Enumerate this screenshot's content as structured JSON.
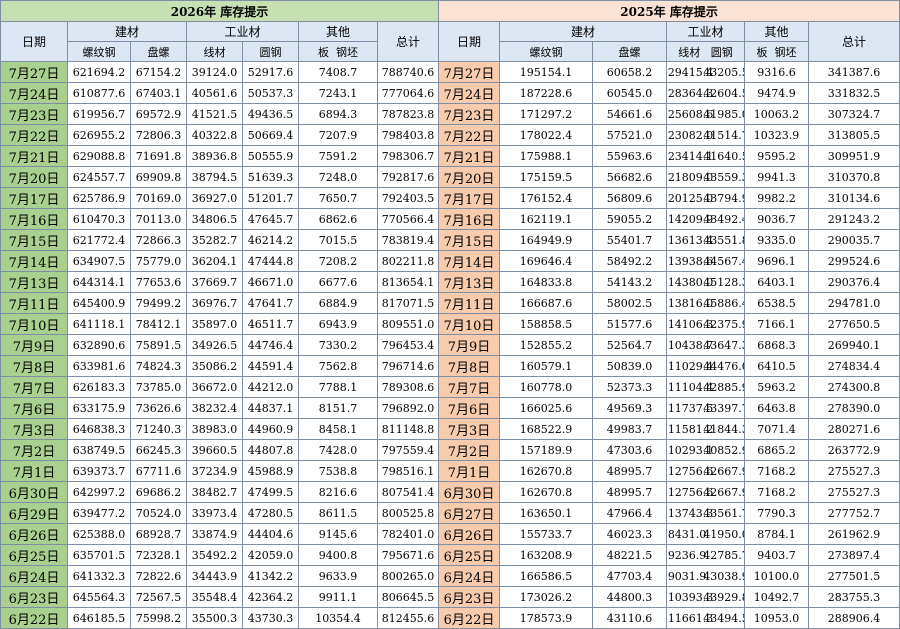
{
  "left_title": "2026年 库存提示",
  "right_title": "2025年 库存提示",
  "headers": {
    "date": "日期",
    "building": "建材",
    "industrial": "工业材",
    "other": "其他",
    "total": "总计",
    "rebar": "螺纹钢",
    "coil": "盘螺",
    "wire": "线材",
    "round": "圆钢",
    "plate": "板",
    "billet": "钢坯"
  },
  "rows_2026": [
    {
      "date": "7月27日",
      "vals": [
        "621694.2",
        "67154.2",
        "39124.0",
        "52917.6",
        "7408.7",
        "788740.6"
      ]
    },
    {
      "date": "7月24日",
      "vals": [
        "610877.6",
        "67403.1",
        "40561.6",
        "50537.3",
        "7243.1",
        "777064.6"
      ]
    },
    {
      "date": "7月23日",
      "vals": [
        "619956.7",
        "69572.9",
        "41521.5",
        "49436.5",
        "6894.3",
        "787823.8"
      ]
    },
    {
      "date": "7月22日",
      "vals": [
        "626955.2",
        "72806.3",
        "40322.8",
        "50669.4",
        "7207.9",
        "798403.8"
      ]
    },
    {
      "date": "7月21日",
      "vals": [
        "629088.8",
        "71691.8",
        "38936.8",
        "50555.9",
        "7591.2",
        "798306.7"
      ]
    },
    {
      "date": "7月20日",
      "vals": [
        "624557.7",
        "69909.8",
        "38794.5",
        "51639.3",
        "7248.0",
        "792817.6"
      ]
    },
    {
      "date": "7月17日",
      "vals": [
        "625786.9",
        "70169.0",
        "36927.0",
        "51201.7",
        "7650.7",
        "792403.5"
      ]
    },
    {
      "date": "7月16日",
      "vals": [
        "610470.3",
        "70113.0",
        "34806.5",
        "47645.7",
        "6862.6",
        "770566.4"
      ]
    },
    {
      "date": "7月15日",
      "vals": [
        "621772.4",
        "72866.3",
        "35282.7",
        "46214.2",
        "7015.5",
        "783819.4"
      ]
    },
    {
      "date": "7月14日",
      "vals": [
        "634907.5",
        "75779.0",
        "36204.1",
        "47444.8",
        "7208.2",
        "802211.8"
      ]
    },
    {
      "date": "7月13日",
      "vals": [
        "644314.1",
        "77653.6",
        "37669.7",
        "46671.0",
        "6677.6",
        "813654.1"
      ]
    },
    {
      "date": "7月11日",
      "vals": [
        "645400.9",
        "79499.2",
        "36976.7",
        "47641.7",
        "6884.9",
        "817071.5"
      ]
    },
    {
      "date": "7月10日",
      "vals": [
        "641118.1",
        "78412.1",
        "35897.0",
        "46511.7",
        "6943.9",
        "809551.0"
      ]
    },
    {
      "date": "7月9日",
      "vals": [
        "632890.6",
        "75891.5",
        "34926.5",
        "44746.4",
        "7330.2",
        "796453.4"
      ]
    },
    {
      "date": "7月8日",
      "vals": [
        "633981.6",
        "74824.3",
        "35086.2",
        "44591.4",
        "7562.8",
        "796714.6"
      ]
    },
    {
      "date": "7月7日",
      "vals": [
        "626183.3",
        "73785.0",
        "36672.0",
        "44212.0",
        "7788.1",
        "789308.6"
      ]
    },
    {
      "date": "7月6日",
      "vals": [
        "633175.9",
        "73626.6",
        "38232.4",
        "44837.1",
        "8151.7",
        "796892.0"
      ]
    },
    {
      "date": "7月3日",
      "vals": [
        "646838.3",
        "71240.3",
        "38983.0",
        "44960.9",
        "8458.1",
        "811148.8"
      ]
    },
    {
      "date": "7月2日",
      "vals": [
        "638749.5",
        "66245.3",
        "39660.5",
        "44807.8",
        "7428.0",
        "797559.4"
      ]
    },
    {
      "date": "7月1日",
      "vals": [
        "639373.7",
        "67711.6",
        "37234.9",
        "45988.9",
        "7538.8",
        "798516.1"
      ]
    },
    {
      "date": "6月30日",
      "vals": [
        "642997.2",
        "69686.2",
        "38482.7",
        "47499.5",
        "8216.6",
        "807541.4"
      ]
    },
    {
      "date": "6月29日",
      "vals": [
        "639477.2",
        "70524.0",
        "33973.4",
        "47280.5",
        "8611.5",
        "800525.8"
      ]
    },
    {
      "date": "6月26日",
      "vals": [
        "625388.0",
        "68928.7",
        "33874.9",
        "44404.6",
        "9145.6",
        "782401.0"
      ]
    },
    {
      "date": "6月25日",
      "vals": [
        "635701.5",
        "72328.1",
        "35492.2",
        "42059.0",
        "9400.8",
        "795671.6"
      ]
    },
    {
      "date": "6月24日",
      "vals": [
        "641332.3",
        "72822.6",
        "34443.9",
        "41342.2",
        "9633.9",
        "800265.0"
      ]
    },
    {
      "date": "6月23日",
      "vals": [
        "645564.3",
        "72567.5",
        "35548.4",
        "42364.2",
        "9911.1",
        "806645.5"
      ]
    },
    {
      "date": "6月22日",
      "vals": [
        "646185.5",
        "75998.2",
        "35500.3",
        "43730.3",
        "10354.4",
        "812455.6"
      ]
    }
  ],
  "rows_2025": [
    {
      "date": "7月27日",
      "vals": [
        "195154.1",
        "60658.2",
        "29415.4",
        "43205.5",
        "9316.6",
        "341387.6"
      ]
    },
    {
      "date": "7月24日",
      "vals": [
        "187228.6",
        "60545.0",
        "28364.3",
        "42604.5",
        "9474.9",
        "331832.5"
      ]
    },
    {
      "date": "7月23日",
      "vals": [
        "171297.2",
        "54661.6",
        "25608.6",
        "41985.0",
        "10063.2",
        "307324.7"
      ]
    },
    {
      "date": "7月22日",
      "vals": [
        "178022.4",
        "57521.0",
        "23082.0",
        "41514.7",
        "10323.9",
        "313805.5"
      ]
    },
    {
      "date": "7月21日",
      "vals": [
        "175988.1",
        "55963.6",
        "23414.1",
        "41640.5",
        "9595.2",
        "309951.9"
      ]
    },
    {
      "date": "7月20日",
      "vals": [
        "175159.5",
        "56682.6",
        "21809.0",
        "43559.3",
        "9941.3",
        "310370.8"
      ]
    },
    {
      "date": "7月17日",
      "vals": [
        "176152.4",
        "56809.6",
        "20125.0",
        "43794.9",
        "9982.2",
        "310134.6"
      ]
    },
    {
      "date": "7月16日",
      "vals": [
        "162119.1",
        "59055.2",
        "14209.9",
        "43492.4",
        "9036.7",
        "291243.2"
      ]
    },
    {
      "date": "7月15日",
      "vals": [
        "164949.9",
        "55401.7",
        "13613.4",
        "43551.8",
        "9335.0",
        "290035.7"
      ]
    },
    {
      "date": "7月14日",
      "vals": [
        "169646.4",
        "58492.2",
        "13938.6",
        "44567.4",
        "9696.1",
        "299524.6"
      ]
    },
    {
      "date": "7月13日",
      "vals": [
        "164833.8",
        "54143.2",
        "14380.0",
        "45128.3",
        "6403.1",
        "290376.4"
      ]
    },
    {
      "date": "7月11日",
      "vals": [
        "166687.6",
        "58002.5",
        "13816.0",
        "45886.4",
        "6538.5",
        "294781.0"
      ]
    },
    {
      "date": "7月10日",
      "vals": [
        "158858.5",
        "51577.6",
        "14106.3",
        "42375.9",
        "7166.1",
        "277650.5"
      ]
    },
    {
      "date": "7月9日",
      "vals": [
        "152855.2",
        "52564.7",
        "10438.7",
        "43647.3",
        "6868.3",
        "269940.1"
      ]
    },
    {
      "date": "7月8日",
      "vals": [
        "160579.1",
        "50839.0",
        "11029.4",
        "44476.0",
        "6410.5",
        "274834.4"
      ]
    },
    {
      "date": "7月7日",
      "vals": [
        "160778.0",
        "52373.3",
        "11104.4",
        "42885.9",
        "5963.2",
        "274300.8"
      ]
    },
    {
      "date": "7月6日",
      "vals": [
        "166025.6",
        "49569.3",
        "11737.5",
        "43397.7",
        "6463.8",
        "278390.0"
      ]
    },
    {
      "date": "7月3日",
      "vals": [
        "168522.9",
        "49983.7",
        "11581.2",
        "41844.3",
        "7071.4",
        "280271.6"
      ]
    },
    {
      "date": "7月2日",
      "vals": [
        "157189.9",
        "47303.6",
        "10293.1",
        "40852.9",
        "6865.2",
        "263772.9"
      ]
    },
    {
      "date": "7月1日",
      "vals": [
        "162670.8",
        "48995.7",
        "12756.6",
        "42667.9",
        "7168.2",
        "275527.3"
      ]
    },
    {
      "date": "6月30日",
      "vals": [
        "162670.8",
        "48995.7",
        "12756.6",
        "42667.9",
        "7168.2",
        "275527.3"
      ]
    },
    {
      "date": "6月27日",
      "vals": [
        "163650.1",
        "47966.4",
        "13743.3",
        "43561.7",
        "7790.3",
        "277752.7"
      ]
    },
    {
      "date": "6月26日",
      "vals": [
        "155733.7",
        "46023.3",
        "8431.0",
        "41950.0",
        "8784.1",
        "261962.9"
      ]
    },
    {
      "date": "6月25日",
      "vals": [
        "163208.9",
        "48221.5",
        "9236.9",
        "42785.7",
        "9403.7",
        "273897.4"
      ]
    },
    {
      "date": "6月24日",
      "vals": [
        "166586.5",
        "47703.4",
        "9031.9",
        "43038.9",
        "10100.0",
        "277501.5"
      ]
    },
    {
      "date": "6月23日",
      "vals": [
        "173026.2",
        "44800.3",
        "10393.3",
        "43929.8",
        "10492.7",
        "283755.3"
      ]
    },
    {
      "date": "6月22日",
      "vals": [
        "178573.9",
        "43110.6",
        "11661.3",
        "43494.5",
        "10953.0",
        "288906.4"
      ]
    }
  ]
}
